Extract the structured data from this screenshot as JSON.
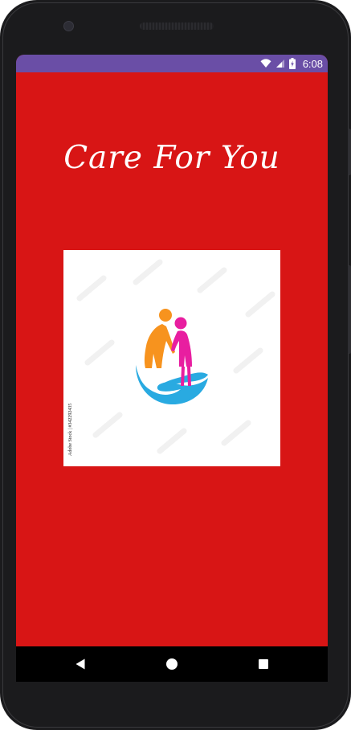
{
  "status_bar": {
    "time": "6:08",
    "color": "#6a4ea6",
    "icons": [
      "wifi-icon",
      "signal-icon",
      "battery-icon"
    ]
  },
  "screen": {
    "background_color": "#d81515",
    "title": "Care For You",
    "logo": {
      "icon": "caregiver-logo-icon",
      "watermark": "Adobe Stock | #342292435",
      "colors": {
        "figure_left": "#f7931e",
        "figure_right": "#e81ea0",
        "hand": "#29aae1"
      }
    }
  },
  "navigation_bar": {
    "back": "back-triangle-icon",
    "home": "home-circle-icon",
    "recents": "recents-square-icon"
  }
}
